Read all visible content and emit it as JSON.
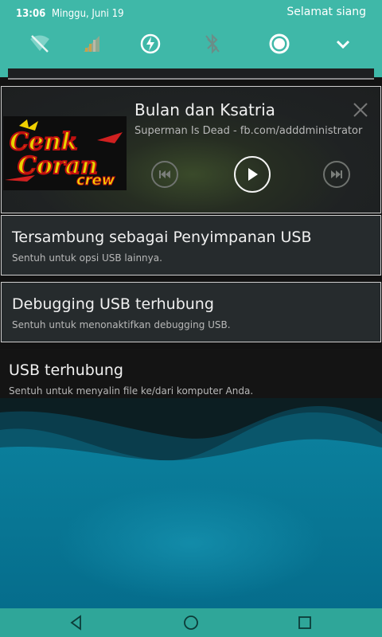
{
  "status_bar": {
    "time": "13:06",
    "date": "Minggu, Juni 19",
    "greeting": "Selamat siang"
  },
  "quick_settings": [
    {
      "icon": "wifi-off-icon",
      "state": "off"
    },
    {
      "icon": "signal-icon",
      "state": "off"
    },
    {
      "icon": "battery-saver-icon",
      "state": "on"
    },
    {
      "icon": "bluetooth-icon",
      "state": "off"
    },
    {
      "icon": "location-icon",
      "state": "on"
    },
    {
      "icon": "expand-chevron-icon",
      "state": "on"
    }
  ],
  "media": {
    "title": "Bulan dan Ksatria",
    "subtitle": "Superman Is Dead - fb.com/adddministrator",
    "album_art_text": [
      "Cenk",
      "Coran",
      "crew"
    ]
  },
  "notifications": [
    {
      "title": "Tersambung sebagai Penyimpanan USB",
      "text": "Sentuh untuk opsi USB lainnya."
    },
    {
      "title": "Debugging USB terhubung",
      "text": "Sentuh untuk menonaktifkan debugging USB."
    },
    {
      "title": "USB terhubung",
      "text": "Sentuh untuk menyalin file ke/dari komputer Anda."
    }
  ],
  "colors": {
    "accent": "#3fb8a8",
    "nav_bar": "#2fa699",
    "wallpaper": "#0a7a96"
  }
}
